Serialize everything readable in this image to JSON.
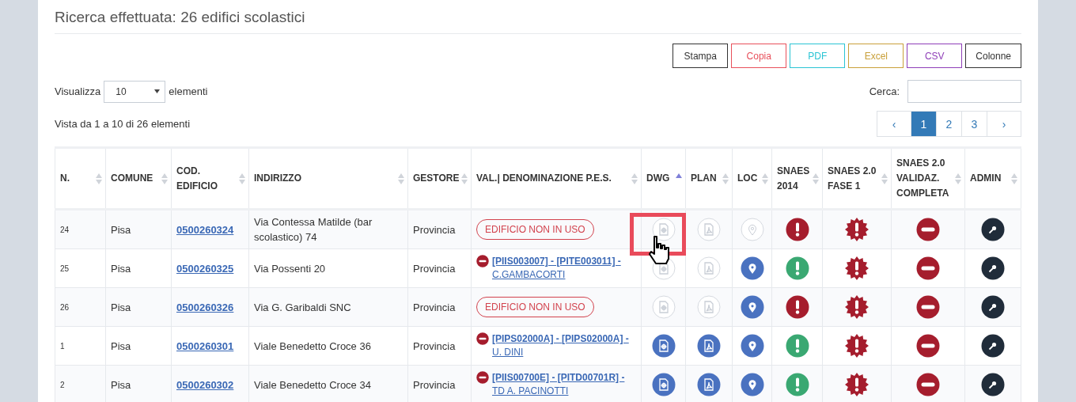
{
  "title": "Ricerca effettuata: 26 edifici scolastici",
  "export_buttons": [
    {
      "label": "Stampa",
      "color": "#333333"
    },
    {
      "label": "Copia",
      "color": "#e8505b"
    },
    {
      "label": "PDF",
      "color": "#2bc4d4"
    },
    {
      "label": "Excel",
      "color": "#c9a03a"
    },
    {
      "label": "CSV",
      "color": "#8f3fb8"
    },
    {
      "label": "Colonne",
      "color": "#333333"
    }
  ],
  "length": {
    "label_before": "Visualizza",
    "value": "10",
    "label_after": "elementi"
  },
  "search": {
    "label": "Cerca:"
  },
  "info": "Vista da 1 a 10 di 26 elementi",
  "pagination": [
    {
      "label": "‹",
      "selected": false
    },
    {
      "label": "1",
      "selected": true
    },
    {
      "label": "2",
      "selected": false
    },
    {
      "label": "3",
      "selected": false
    },
    {
      "label": "›",
      "selected": false
    }
  ],
  "columns": [
    {
      "label": "N.",
      "sorted_ascending": false
    },
    {
      "label": "COMUNE",
      "sorted_ascending": false
    },
    {
      "label": "COD. EDIFICIO",
      "sorted_ascending": false
    },
    {
      "label": "INDIRIZZO",
      "sorted_ascending": false
    },
    {
      "label": "GESTORE",
      "sorted_ascending": false
    },
    {
      "label": "VAL.| DENOMINAZIONE P.E.S.",
      "sorted_ascending": false
    },
    {
      "label": "DWG",
      "sorted_ascending": true
    },
    {
      "label": "PLAN",
      "sorted_ascending": false
    },
    {
      "label": "LOC",
      "sorted_ascending": false
    },
    {
      "label": "SNAES 2014",
      "sorted_ascending": false
    },
    {
      "label": "SNAES 2.0 FASE 1",
      "sorted_ascending": false
    },
    {
      "label": "SNAES 2.0 VALIDAZ. COMPLETA",
      "sorted_ascending": false
    },
    {
      "label": "ADMIN",
      "sorted_ascending": false
    }
  ],
  "rows": [
    {
      "n": "24",
      "comune": "Pisa",
      "code": "0500260324",
      "address": "Via Contessa Matilde (bar scolastico) 74",
      "gestore": "Provincia",
      "pes": {
        "kind": "unused",
        "text": "EDIFICIO NON IN USO"
      },
      "dwg": {
        "available": false,
        "highlighted": true
      },
      "plan": false,
      "loc": false,
      "snaes2014_ok": false,
      "fase1_ok": false,
      "validaz_ok": false
    },
    {
      "n": "25",
      "comune": "Pisa",
      "code": "0500260325",
      "address": "Via Possenti 20",
      "gestore": "Provincia",
      "pes": {
        "kind": "link",
        "text": "**[PIIS003007] - [PITE003011] -** C.GAMBACORTI"
      },
      "dwg": {
        "available": false,
        "highlighted": false
      },
      "plan": false,
      "loc": true,
      "snaes2014_ok": true,
      "fase1_ok": false,
      "validaz_ok": false
    },
    {
      "n": "26",
      "comune": "Pisa",
      "code": "0500260326",
      "address": "Via G. Garibaldi SNC",
      "gestore": "Provincia",
      "pes": {
        "kind": "unused",
        "text": "EDIFICIO NON IN USO"
      },
      "dwg": {
        "available": false,
        "highlighted": false
      },
      "plan": false,
      "loc": true,
      "snaes2014_ok": false,
      "fase1_ok": false,
      "validaz_ok": false
    },
    {
      "n": "1",
      "comune": "Pisa",
      "code": "0500260301",
      "address": "Viale Benedetto Croce 36",
      "gestore": "Provincia",
      "pes": {
        "kind": "link",
        "text": "**[PIPS02000A] - [PIPS02000A] -** U. DINI"
      },
      "dwg": {
        "available": true,
        "highlighted": false
      },
      "plan": true,
      "loc": true,
      "snaes2014_ok": true,
      "fase1_ok": false,
      "validaz_ok": false
    },
    {
      "n": "2",
      "comune": "Pisa",
      "code": "0500260302",
      "address": "Viale Benedetto Croce 34",
      "gestore": "Provincia",
      "pes": {
        "kind": "link",
        "text": "**[PIIS00700E] - [PITD00701R] -** TD A. PACINOTTI"
      },
      "dwg": {
        "available": true,
        "highlighted": false
      },
      "plan": true,
      "loc": true,
      "snaes2014_ok": true,
      "fase1_ok": false,
      "validaz_ok": false
    }
  ]
}
